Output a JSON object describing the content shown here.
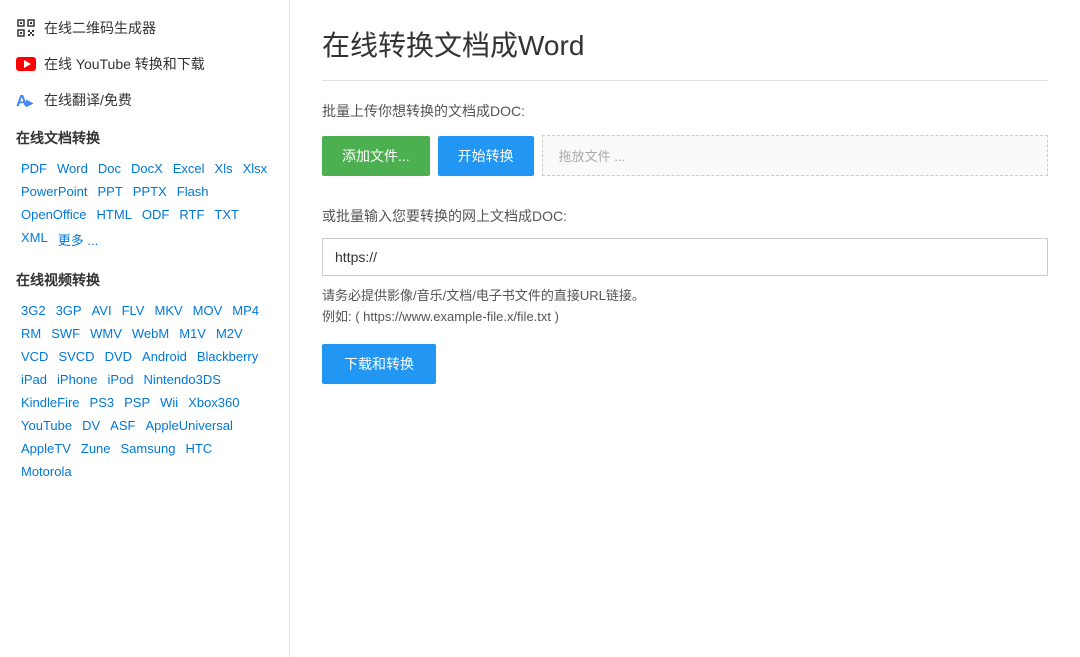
{
  "sidebar": {
    "menu_items": [
      {
        "id": "qr",
        "label": "在线二维码生成器",
        "icon": "qr-icon"
      },
      {
        "id": "youtube",
        "label": "在线 YouTube 转换和下载",
        "icon": "youtube-icon"
      },
      {
        "id": "translate",
        "label": "在线翻译/免费",
        "icon": "translate-icon"
      }
    ],
    "doc_section_title": "在线文档转换",
    "doc_formats": [
      "PDF",
      "Word",
      "Doc",
      "DocX",
      "Excel",
      "Xls",
      "Xlsx",
      "PowerPoint",
      "PPT",
      "PPTX",
      "Flash",
      "OpenOffice",
      "HTML",
      "ODF",
      "RTF",
      "TXT",
      "XML",
      "更多 ..."
    ],
    "video_section_title": "在线视频转换",
    "video_formats": [
      "3G2",
      "3GP",
      "AVI",
      "FLV",
      "MKV",
      "MOV",
      "MP4",
      "RM",
      "SWF",
      "WMV",
      "WebM",
      "M1V",
      "M2V",
      "VCD",
      "SVCD",
      "DVD",
      "Android",
      "Blackberry",
      "iPad",
      "iPhone",
      "iPod",
      "Nintendo3DS",
      "KindleFire",
      "PS3",
      "PSP",
      "Wii",
      "Xbox360",
      "YouTube",
      "DV",
      "ASF",
      "AppleUniversal",
      "AppleTV",
      "Zune",
      "Samsung",
      "HTC",
      "Motorola"
    ]
  },
  "main": {
    "page_title": "在线转换文档成Word",
    "upload_label": "批量上传你想转换的文档成DOC:",
    "add_file_btn": "添加文件...",
    "start_convert_btn": "开始转换",
    "drop_placeholder": "拖放文件 ...",
    "url_label": "或批量输入您要转换的网上文档成DOC:",
    "url_placeholder": "https://",
    "url_hint_line1": "请务必提供影像/音乐/文档/电子书文件的直接URL链接。",
    "url_hint_line2": "例如: ( https://www.example-file.x/file.txt )",
    "download_convert_btn": "下载和转换"
  }
}
